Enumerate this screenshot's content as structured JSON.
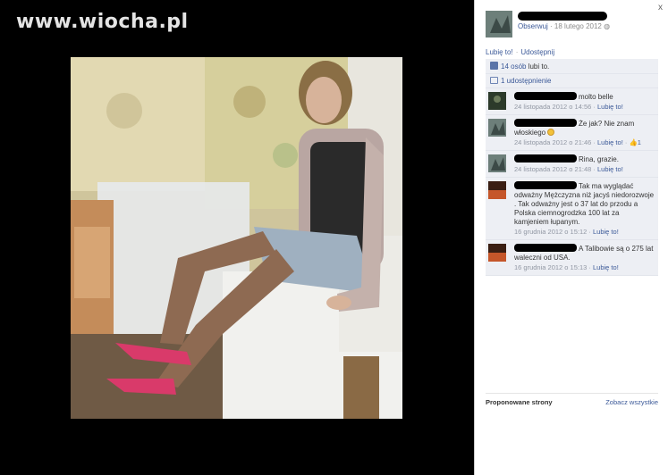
{
  "watermark": "www.wiocha.pl",
  "header": {
    "follow": "Obserwuj",
    "date": "18 lutego 2012",
    "close": "x"
  },
  "actions": {
    "like": "Lubię to!",
    "share": "Udostępnij"
  },
  "stats": {
    "likes_count": "14 osób",
    "likes_suffix": " lubi to.",
    "shares": "1 udostępnienie"
  },
  "comments": [
    {
      "text": "molto belle",
      "time": "24 listopada 2012 o 14:56",
      "like": "Lubię to!",
      "like_count": ""
    },
    {
      "text": "Że jak? Nie znam włoskiego",
      "time": "24 listopada 2012 o 21:46",
      "like": "Lubię to!",
      "like_count": "1"
    },
    {
      "text": "Rina, grazie.",
      "time": "24 listopada 2012 o 21:48",
      "like": "Lubię to!",
      "like_count": ""
    },
    {
      "text": "Tak ma wyglądać odważny Mężczyzna niż jacyś niedorozwoje . Tak odważny jest o 37 lat do przodu a Polska ciemnogrodzka 100 lat za kamjeniem łupanym.",
      "time": "16 grudnia 2012 o 15:12",
      "like": "Lubię to!",
      "like_count": ""
    },
    {
      "text": "A Talibowie są o 275 lat waleczni od USA.",
      "time": "16 grudnia 2012 o 15:13",
      "like": "Lubię to!",
      "like_count": ""
    }
  ],
  "proposed": {
    "title": "Proponowane strony",
    "see_all": "Zobacz wszystkie"
  },
  "colors": {
    "link": "#3b5998",
    "panel_bg": "#edeff4",
    "meta": "#9197a3"
  }
}
